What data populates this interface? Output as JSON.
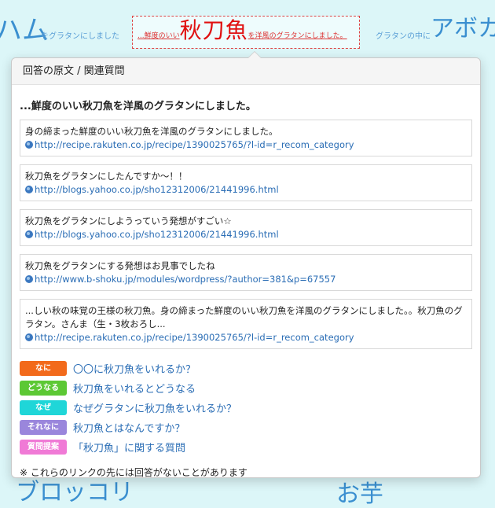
{
  "background_words": {
    "w1": "ハム",
    "w1_tail": "をグラタンにしました",
    "w2": "グラタンの中に",
    "w3": "アボカ",
    "w4": "ブロッコリ",
    "w5": "お芋"
  },
  "highlight": {
    "prefix": "...鮮度のいい",
    "keyword": "秋刀魚",
    "suffix": "を洋風のグラタンにしました。"
  },
  "popup": {
    "header": "回答の原文 / 関連質問",
    "answer_title": "...鮮度のいい秋刀魚を洋風のグラタンにしました。",
    "answers": [
      {
        "text": "身の締まった鮮度のいい秋刀魚を洋風のグラタンにしました。",
        "url": "http://recipe.rakuten.co.jp/recipe/1390025765/?l-id=r_recom_category"
      },
      {
        "text": "秋刀魚をグラタンにしたんですか～！！",
        "url": "http://blogs.yahoo.co.jp/sho12312006/21441996.html"
      },
      {
        "text": "秋刀魚をグラタンにしようっていう発想がすごい☆",
        "url": "http://blogs.yahoo.co.jp/sho12312006/21441996.html"
      },
      {
        "text": "秋刀魚をグラタンにする発想はお見事でしたね",
        "url": "http://www.b-shoku.jp/modules/wordpress/?author=381&p=67557"
      },
      {
        "text": "...しい秋の味覚の王様の秋刀魚。身の締まった鮮度のいい秋刀魚を洋風のグラタンにしました。。秋刀魚のグラタン。さんま（生・3枚おろし...",
        "url": "http://recipe.rakuten.co.jp/recipe/1390025765/?l-id=r_recom_category"
      }
    ],
    "questions": [
      {
        "badge": "なに",
        "color": "#f26a1b",
        "text": "〇〇に秋刀魚をいれるか？"
      },
      {
        "badge": "どうなる",
        "color": "#5cc834",
        "text": "秋刀魚をいれるとどうなる"
      },
      {
        "badge": "なぜ",
        "color": "#1fd6d8",
        "text": "なぜグラタンに秋刀魚をいれるか？"
      },
      {
        "badge": "それなに",
        "color": "#9a86dc",
        "text": "秋刀魚とはなんですか？"
      },
      {
        "badge": "質問提案",
        "color": "#f07ad6",
        "text": "「秋刀魚」に関する質問"
      }
    ],
    "note": "※ これらのリンクの先には回答がないことがあります"
  }
}
